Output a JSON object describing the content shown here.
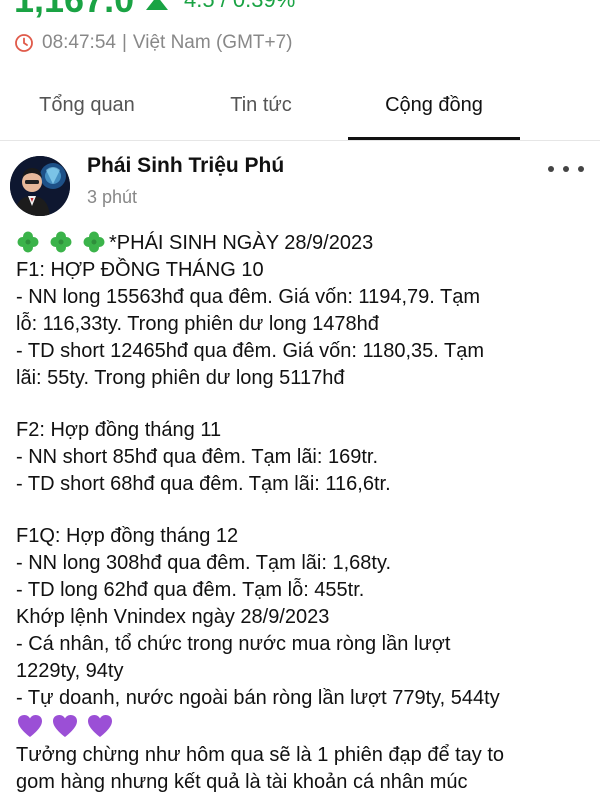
{
  "quote": {
    "price": "1,167.0",
    "change": "4.5 / 0.39%",
    "up_color": "#1aa344",
    "time": "08:47:54",
    "timezone": "Việt Nam (GMT+7)",
    "separator": "|"
  },
  "tabs": [
    {
      "label": "Tổng quan",
      "active": false
    },
    {
      "label": "Tin tức",
      "active": false
    },
    {
      "label": "Cộng đồng",
      "active": true
    }
  ],
  "post": {
    "author": "Phái Sinh Triệu Phú",
    "time_ago": "3 phút",
    "lines": {
      "l1": "*PHÁI SINH NGÀY 28/9/2023",
      "l2": "F1: HỢP ĐỒNG THÁNG 10",
      "l3": "- NN long 15563hđ qua đêm. Giá vốn: 1194,79. Tạm",
      "l4": "lỗ: 116,33ty. Trong phiên dư long 1478hđ",
      "l5": "- TD short 12465hđ qua đêm. Giá vốn: 1180,35. Tạm",
      "l6": "lãi: 55ty. Trong phiên dư long 5117hđ",
      "l7": "F2: Hợp đồng tháng 11",
      "l8": "- NN short 85hđ qua đêm. Tạm lãi: 169tr.",
      "l9": "- TD short 68hđ qua đêm. Tạm lãi: 116,6tr.",
      "l10": "F1Q: Hợp đồng tháng 12",
      "l11": "- NN long 308hđ qua đêm. Tạm lãi: 1,68ty.",
      "l12": "- TD long 62hđ qua đêm. Tạm lỗ: 455tr.",
      "l13": "Khớp lệnh Vnindex ngày 28/9/2023",
      "l14": "- Cá nhân, tổ chức trong nước mua ròng lần lượt",
      "l15": "1229ty, 94ty",
      "l16": "- Tự doanh, nước ngoài bán ròng lần lượt 779ty, 544ty",
      "l17": "Tưởng chừng như hôm qua sẽ là 1 phiên đạp để tay to",
      "l18": "gom hàng nhưng kết quả là tài khoản cá nhân múc"
    }
  }
}
